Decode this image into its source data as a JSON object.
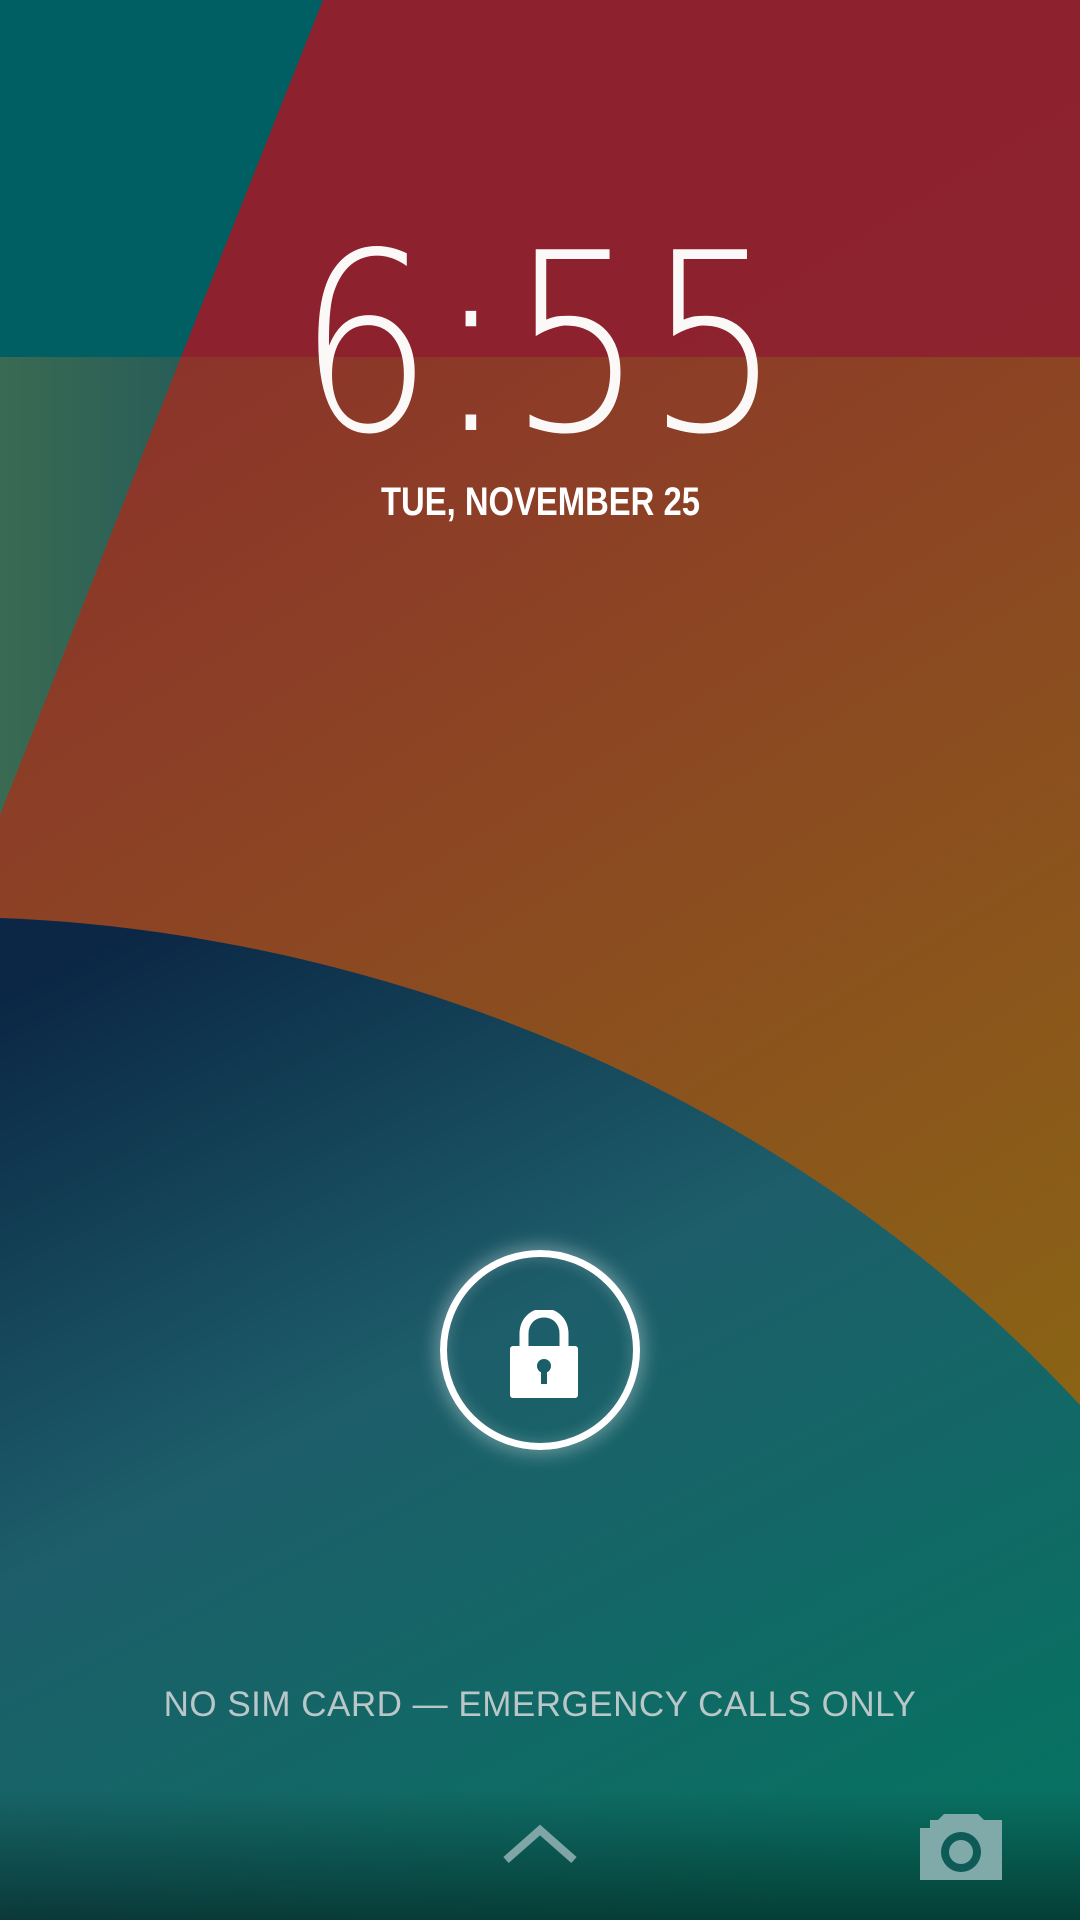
{
  "lockscreen": {
    "time": "6:55",
    "date": "TUE, NOVEMBER 25",
    "carrier_text": "NO SIM CARD — EMERGENCY CALLS ONLY"
  },
  "icons": {
    "lock": "lock-icon",
    "unlock_hint": "chevron-up-icon",
    "camera": "camera-icon"
  },
  "colors": {
    "wallpaper_red": "#8d212f",
    "wallpaper_orange": "#8b4a22",
    "wallpaper_teal": "#006063",
    "wallpaper_navy": "#0d2b45",
    "wallpaper_mustard": "#8b6512",
    "text": "#ffffff",
    "carrier_text": "#b9c7c9"
  }
}
